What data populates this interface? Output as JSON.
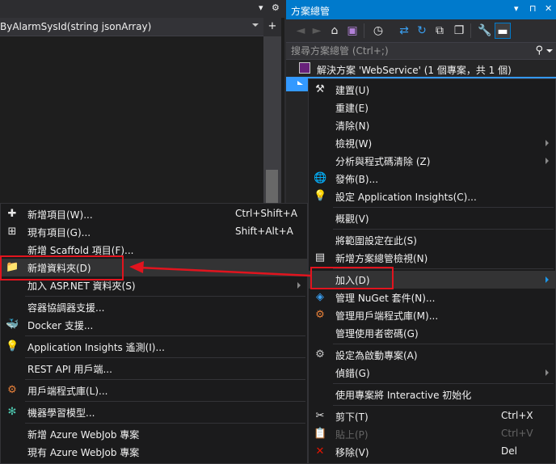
{
  "editor": {
    "nav_text": "ByAlarmSysId(string jsonArray)",
    "tab_dropdown": "▾",
    "tab_settings": "⚙"
  },
  "solution_explorer": {
    "title": "方案總管",
    "title_controls": [
      "▾",
      "⊓",
      "✕"
    ],
    "search_placeholder": "搜尋方案總管 (Ctrl+;)",
    "solution_label": "解決方案 'WebService' (1 個專案，共 1 個)"
  },
  "main_menu": {
    "items": [
      {
        "label": "建置(U)",
        "icon": "build-icon",
        "shortcut": "",
        "submenu": false
      },
      {
        "label": "重建(E)",
        "icon": "",
        "shortcut": "",
        "submenu": false
      },
      {
        "label": "清除(N)",
        "icon": "",
        "shortcut": "",
        "submenu": false
      },
      {
        "label": "檢視(W)",
        "icon": "",
        "shortcut": "",
        "submenu": true
      },
      {
        "label": "分析與程式碼清除 (Z)",
        "icon": "",
        "shortcut": "",
        "submenu": true
      },
      {
        "label": "發佈(B)...",
        "icon": "globe-icon",
        "shortcut": "",
        "submenu": false
      },
      {
        "label": "設定 Application Insights(C)...",
        "icon": "insights-icon",
        "shortcut": "",
        "submenu": false
      },
      {
        "label": "概觀(V)",
        "icon": "",
        "shortcut": "",
        "submenu": false
      },
      {
        "label": "將範圍設定在此(S)",
        "icon": "",
        "shortcut": "",
        "submenu": false
      },
      {
        "label": "新增方案總管檢視(N)",
        "icon": "new-view-icon",
        "shortcut": "",
        "submenu": false
      },
      {
        "label": "加入(D)",
        "icon": "",
        "shortcut": "",
        "submenu": true,
        "highlighted": true
      },
      {
        "label": "管理 NuGet 套件(N)...",
        "icon": "nuget-icon",
        "shortcut": "",
        "submenu": false
      },
      {
        "label": "管理用戶端程式庫(M)...",
        "icon": "library-icon",
        "shortcut": "",
        "submenu": false
      },
      {
        "label": "管理使用者密碼(G)",
        "icon": "",
        "shortcut": "",
        "submenu": false
      },
      {
        "label": "設定為啟動專案(A)",
        "icon": "gear-icon",
        "shortcut": "",
        "submenu": false
      },
      {
        "label": "偵錯(G)",
        "icon": "",
        "shortcut": "",
        "submenu": true
      },
      {
        "label": "使用專案將 Interactive 初始化",
        "icon": "",
        "shortcut": "",
        "submenu": false
      },
      {
        "label": "剪下(T)",
        "icon": "scissors-icon",
        "shortcut": "Ctrl+X",
        "submenu": false
      },
      {
        "label": "貼上(P)",
        "icon": "paste-icon",
        "shortcut": "Ctrl+V",
        "submenu": false,
        "disabled": true
      },
      {
        "label": "移除(V)",
        "icon": "close-icon",
        "shortcut": "Del",
        "submenu": false
      }
    ]
  },
  "add_menu": {
    "items": [
      {
        "label": "新增項目(W)...",
        "icon": "new-item-icon",
        "shortcut": "Ctrl+Shift+A",
        "submenu": false
      },
      {
        "label": "現有項目(G)...",
        "icon": "existing-item-icon",
        "shortcut": "Shift+Alt+A",
        "submenu": false
      },
      {
        "label": "新增 Scaffold 項目(F)...",
        "icon": "",
        "shortcut": "",
        "submenu": false
      },
      {
        "label": "新增資料夾(D)",
        "icon": "new-folder-icon",
        "shortcut": "",
        "submenu": false,
        "highlighted": true
      },
      {
        "label": "加入 ASP.NET 資料夾(S)",
        "icon": "",
        "shortcut": "",
        "submenu": true
      },
      {
        "label": "容器協調器支援...",
        "icon": "",
        "shortcut": "",
        "submenu": false
      },
      {
        "label": "Docker 支援...",
        "icon": "docker-icon",
        "shortcut": "",
        "submenu": false
      },
      {
        "label": "Application Insights 遙測(I)...",
        "icon": "insights-icon",
        "shortcut": "",
        "submenu": false
      },
      {
        "label": "REST API 用戶端...",
        "icon": "",
        "shortcut": "",
        "submenu": false
      },
      {
        "label": "用戶端程式庫(L)...",
        "icon": "library-icon",
        "shortcut": "",
        "submenu": false
      },
      {
        "label": "機器學習模型...",
        "icon": "ml-model-icon",
        "shortcut": "",
        "submenu": false
      },
      {
        "label": "新增 Azure WebJob 專案",
        "icon": "",
        "shortcut": "",
        "submenu": false
      },
      {
        "label": "現有 Azure WebJob 專案",
        "icon": "",
        "shortcut": "",
        "submenu": false
      }
    ]
  },
  "colors": {
    "accent": "#007acc",
    "highlight_box": "#e1141e",
    "menu_bg": "#1b1b1c",
    "selection": "#3399ff"
  }
}
